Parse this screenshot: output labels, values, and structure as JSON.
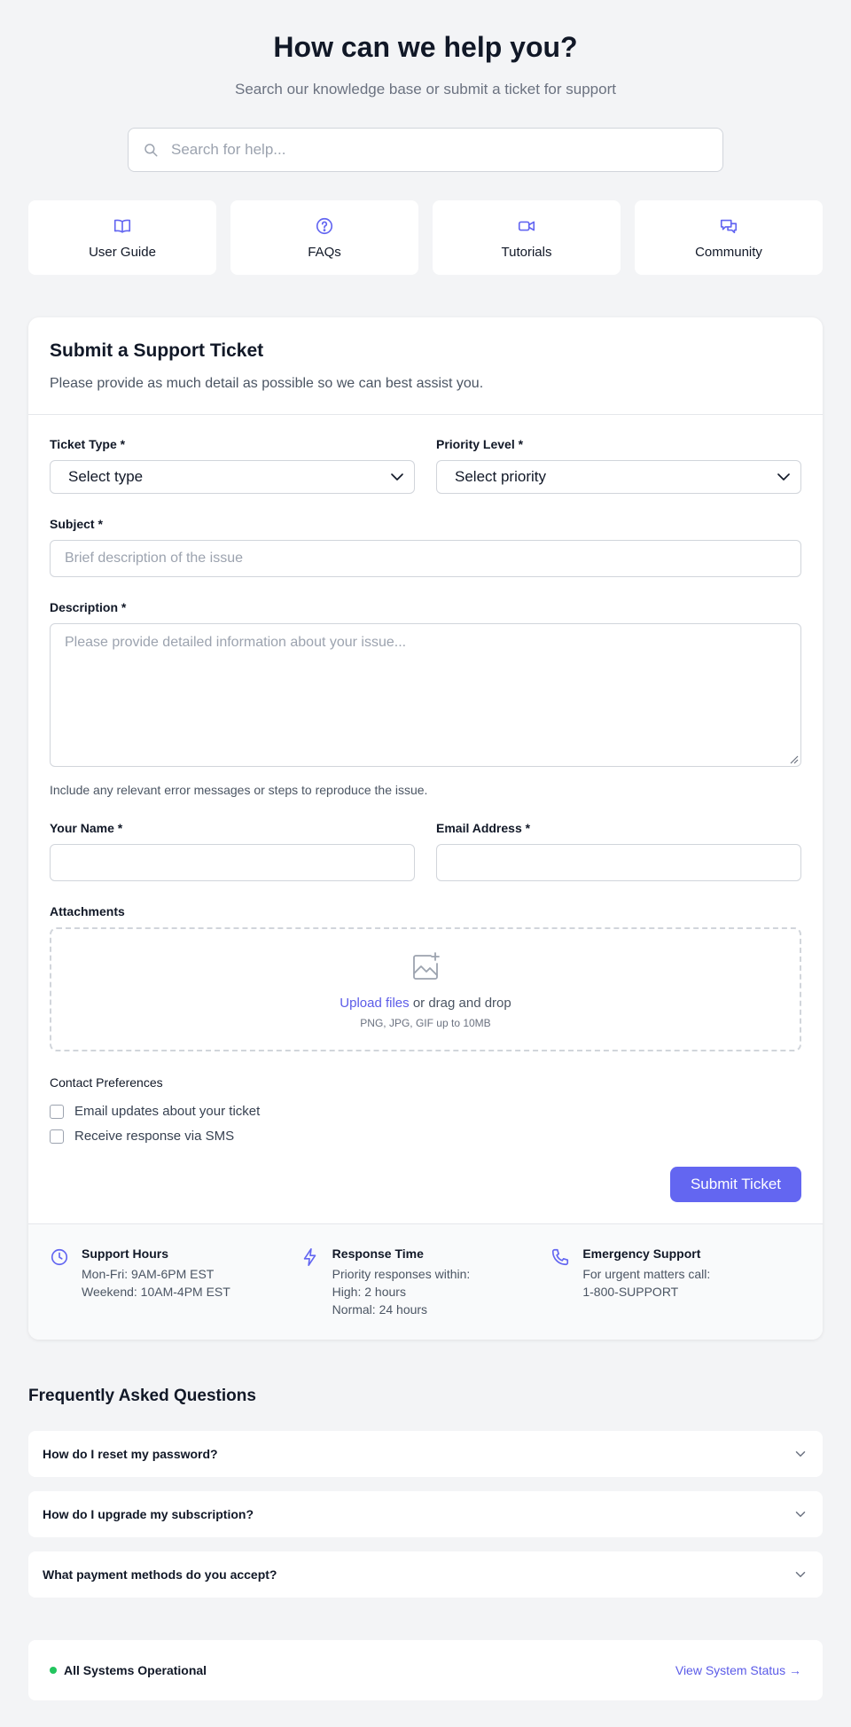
{
  "hero": {
    "title": "How can we help you?",
    "subtitle": "Search our knowledge base or submit a ticket for support"
  },
  "search": {
    "placeholder": "Search for help..."
  },
  "quick_links": [
    {
      "label": "User Guide",
      "icon": "book-icon"
    },
    {
      "label": "FAQs",
      "icon": "question-circle-icon"
    },
    {
      "label": "Tutorials",
      "icon": "video-icon"
    },
    {
      "label": "Community",
      "icon": "chat-bubbles-icon"
    }
  ],
  "ticket": {
    "title": "Submit a Support Ticket",
    "subtitle": "Please provide as much detail as possible so we can best assist you.",
    "type_label": "Ticket Type *",
    "type_value": "Select type",
    "priority_label": "Priority Level *",
    "priority_value": "Select priority",
    "subject_label": "Subject *",
    "subject_placeholder": "Brief description of the issue",
    "description_label": "Description *",
    "description_placeholder": "Please provide detailed information about your issue...",
    "description_hint": "Include any relevant error messages or steps to reproduce the issue.",
    "name_label": "Your Name *",
    "email_label": "Email Address *",
    "attachments_label": "Attachments",
    "upload_link": "Upload files",
    "upload_suffix": " or drag and drop",
    "upload_note": "PNG, JPG, GIF up to 10MB",
    "prefs_label": "Contact Preferences",
    "pref_email": "Email updates about your ticket",
    "pref_sms": "Receive response via SMS",
    "submit_label": "Submit Ticket"
  },
  "info": [
    {
      "title": "Support Hours",
      "icon": "clock-icon",
      "lines": [
        "Mon-Fri: 9AM-6PM EST",
        "Weekend: 10AM-4PM EST"
      ]
    },
    {
      "title": "Response Time",
      "icon": "lightning-icon",
      "lines": [
        "Priority responses within:",
        "High: 2 hours",
        "Normal: 24 hours"
      ]
    },
    {
      "title": "Emergency Support",
      "icon": "phone-icon",
      "lines": [
        "For urgent matters call:",
        "1-800-SUPPORT"
      ]
    }
  ],
  "faq": {
    "title": "Frequently Asked Questions",
    "items": [
      "How do I reset my password?",
      "How do I upgrade my subscription?",
      "What payment methods do you accept?"
    ]
  },
  "status": {
    "text": "All Systems Operational",
    "link": "View System Status →"
  },
  "colors": {
    "accent": "#6366f1",
    "status_ok": "#22c55e",
    "background": "#f3f4f6"
  }
}
